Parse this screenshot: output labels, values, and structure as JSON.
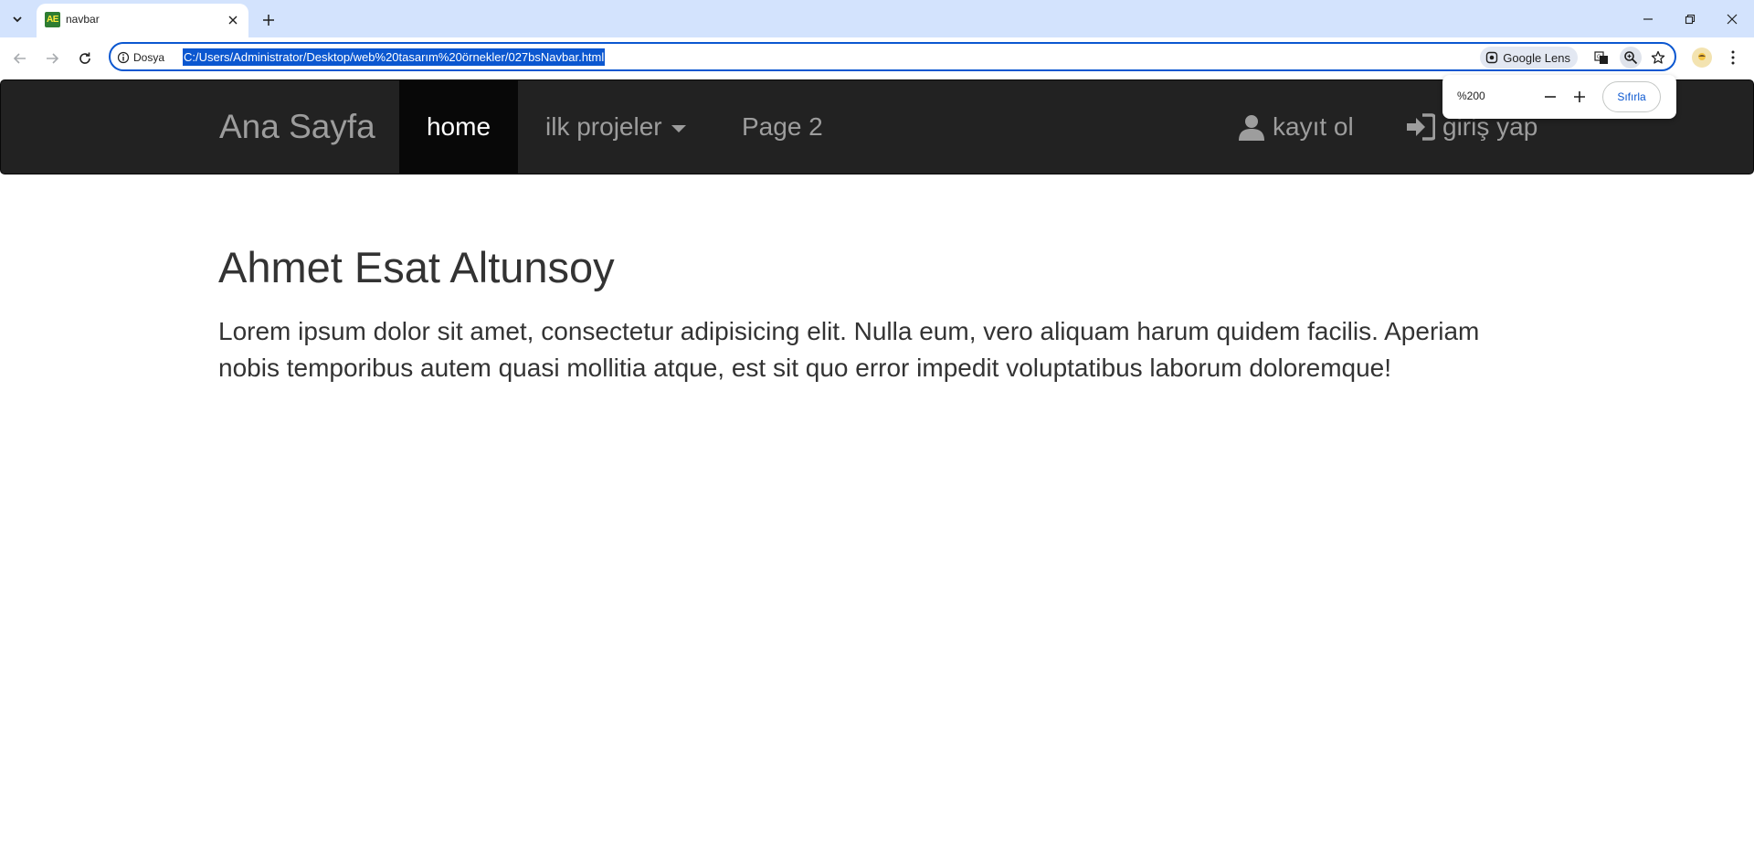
{
  "browser": {
    "tab": {
      "title": "navbar",
      "favicon_text": "AE"
    },
    "address_bar": {
      "site_label": "Dosya",
      "url": "C:/Users/Administrator/Desktop/web%20tasarım%20örnekler/027bsNavbar.html",
      "lens_label": "Google Lens"
    },
    "zoom_popup": {
      "level": "%200",
      "reset_label": "Sıfırla"
    }
  },
  "page": {
    "navbar": {
      "brand": "Ana Sayfa",
      "items": [
        {
          "label": "home"
        },
        {
          "label": "ilk projeler"
        },
        {
          "label": "Page 2"
        }
      ],
      "right_items": [
        {
          "label": "kayıt ol",
          "icon": "user-icon"
        },
        {
          "label": "giriş yap",
          "icon": "login-icon"
        }
      ]
    },
    "content": {
      "heading": "Ahmet Esat Altunsoy",
      "paragraph": "Lorem ipsum dolor sit amet, consectetur adipisicing elit. Nulla eum, vero aliquam harum quidem facilis. Aperiam nobis temporibus autem quasi mollitia atque, est sit quo error impedit voluptatibus laborum doloremque!"
    }
  },
  "colors": {
    "navbar_bg": "#222222",
    "navbar_active_bg": "#080808",
    "navbar_text": "#9d9d9d",
    "accent": "#0b57d0",
    "tabstrip_bg": "#d3e3fd"
  }
}
